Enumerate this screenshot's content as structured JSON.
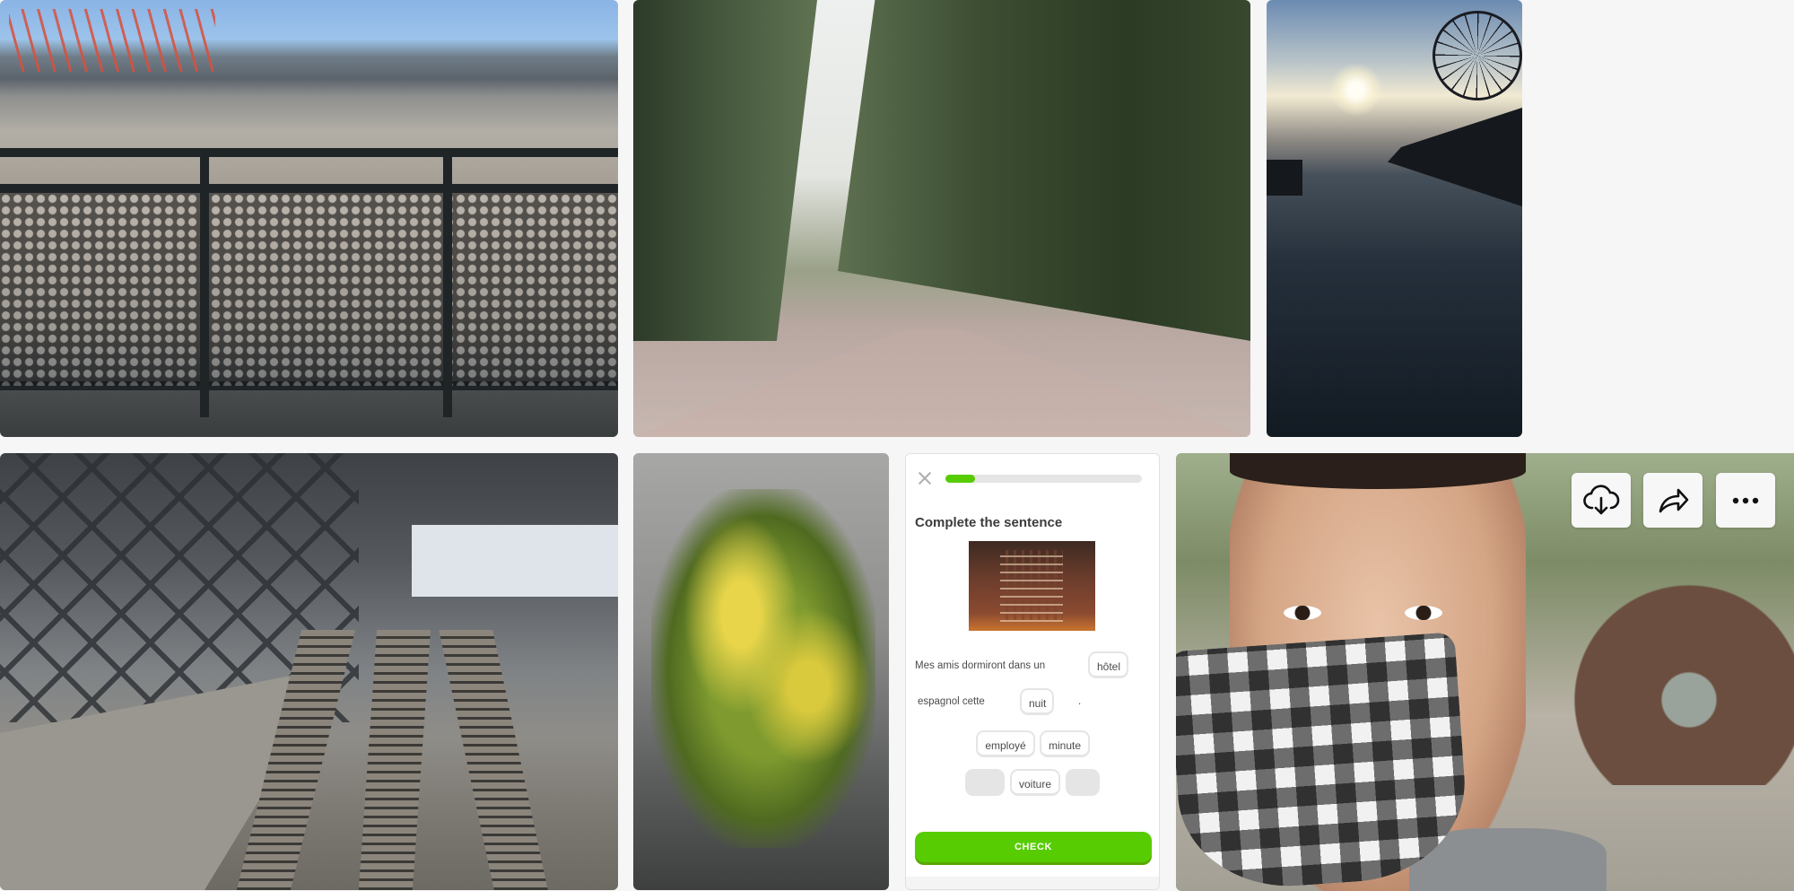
{
  "quiz": {
    "title": "Complete the sentence",
    "progress": 0.15,
    "line1": [
      "Mes",
      "amis",
      "dormiront",
      "dans",
      "un"
    ],
    "answer_word": "hôtel",
    "line2": [
      "espagnol",
      "cette"
    ],
    "line2_end": ".",
    "placed_word": "nuit",
    "bank_row1": [
      "employé",
      "minute"
    ],
    "bank_row2_word": "voiture",
    "check_label": "CHECK"
  },
  "actions": {
    "download": "cloud-download-icon",
    "share": "share-arrow-icon",
    "more": "more-dots-icon"
  },
  "colors": {
    "accent": "#58cc02",
    "background": "#f6f6f6"
  }
}
